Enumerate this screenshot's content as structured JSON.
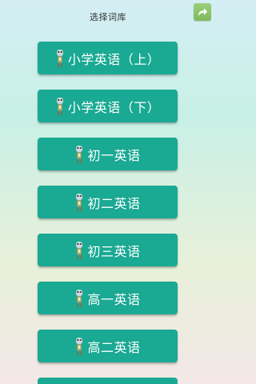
{
  "header": {
    "title": "选择词库"
  },
  "icons": {
    "share": "share-arrow-icon",
    "mascot": "mascot-figure-icon"
  },
  "colors": {
    "button": "#1aa993",
    "share_button": "#86c265"
  },
  "libraries": [
    {
      "label": "小学英语（上）"
    },
    {
      "label": "小学英语（下）"
    },
    {
      "label": "初一英语"
    },
    {
      "label": "初二英语"
    },
    {
      "label": "初三英语"
    },
    {
      "label": "高一英语"
    },
    {
      "label": "高二英语"
    },
    {
      "label": ""
    }
  ]
}
